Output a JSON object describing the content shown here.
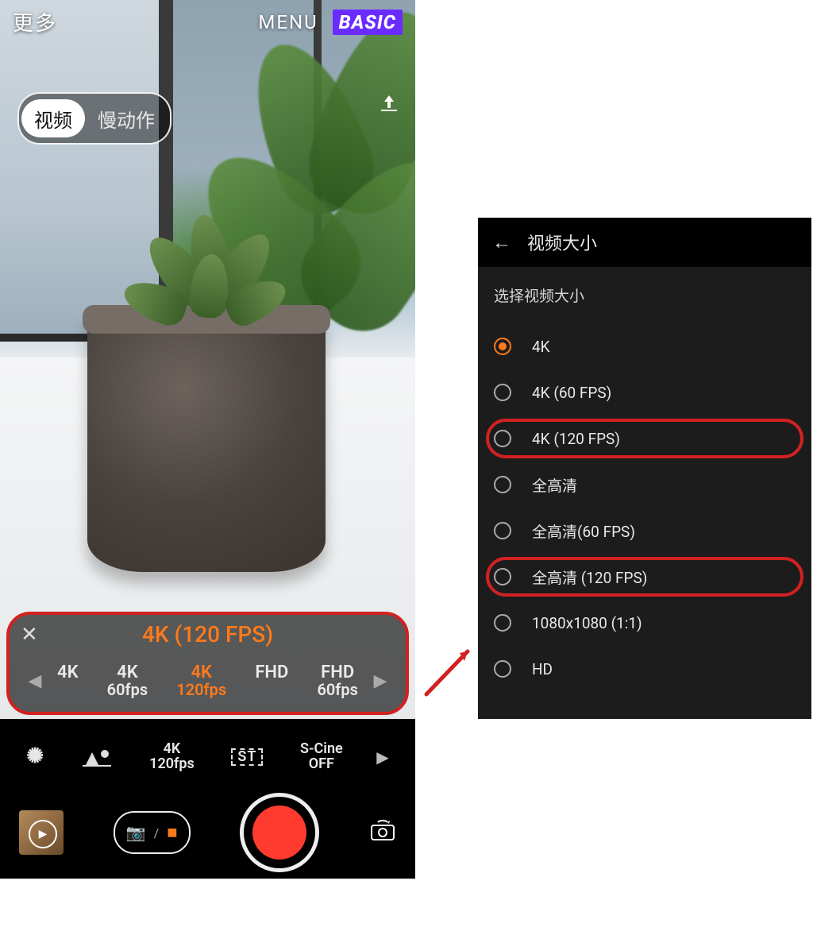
{
  "left": {
    "top": {
      "more": "更多",
      "menu": "MENU",
      "badge": "BASIC"
    },
    "mode": {
      "video": "视频",
      "slowmo": "慢动作",
      "selected": "video"
    },
    "res_picker": {
      "title": "4K (120 FPS)",
      "options": [
        {
          "main": "4K",
          "sub": ""
        },
        {
          "main": "4K",
          "sub": "60fps"
        },
        {
          "main": "4K",
          "sub": "120fps"
        },
        {
          "main": "FHD",
          "sub": ""
        },
        {
          "main": "FHD",
          "sub": "60fps"
        }
      ],
      "active_index": 2
    },
    "quick": {
      "res_l1": "4K",
      "res_l2": "120fps",
      "st": "ST",
      "scine_l1": "S-Cine",
      "scine_l2": "OFF"
    }
  },
  "right": {
    "header": "视频大小",
    "section": "选择视频大小",
    "options": [
      {
        "label": "4K",
        "selected": true,
        "highlight": false
      },
      {
        "label": "4K (60 FPS)",
        "selected": false,
        "highlight": false
      },
      {
        "label": "4K (120 FPS)",
        "selected": false,
        "highlight": true
      },
      {
        "label": "全高清",
        "selected": false,
        "highlight": false
      },
      {
        "label": "全高清(60 FPS)",
        "selected": false,
        "highlight": false
      },
      {
        "label": "全高清 (120 FPS)",
        "selected": false,
        "highlight": true
      },
      {
        "label": "1080x1080 (1:1)",
        "selected": false,
        "highlight": false
      },
      {
        "label": "HD",
        "selected": false,
        "highlight": false
      }
    ]
  }
}
